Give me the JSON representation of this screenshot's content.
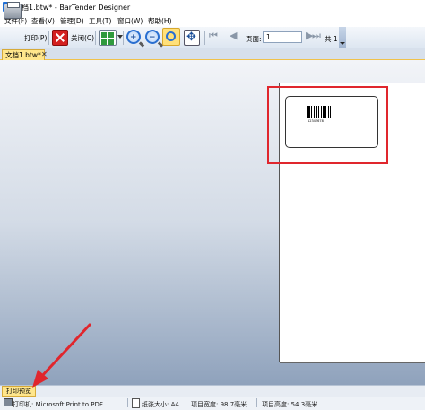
{
  "window": {
    "title": "文档1.btw* - BarTender Designer"
  },
  "menu": {
    "items": [
      "文件(F)",
      "查看(V)",
      "管理(D)",
      "工具(T)",
      "窗口(W)",
      "帮助(H)"
    ]
  },
  "toolbar": {
    "print_label": "打印(P)",
    "close_label": "关闭(C)",
    "page_label": "页面:",
    "page_value": "1",
    "total_label": "共 1"
  },
  "document": {
    "tab_label": "文档1.btw*",
    "tab_close": "✕",
    "barcode_text": "12345678"
  },
  "bottom": {
    "preview_tab": "打印预览"
  },
  "status": {
    "printer": "打印机: Microsoft Print to PDF",
    "paper_size": "纸张大小: A4",
    "item_width": "项目宽度: 98.7毫米",
    "item_height": "项目高度: 54.3毫米"
  },
  "colors": {
    "highlight": "#e0262d",
    "tab_active": "#ffe68c"
  },
  "icons": [
    "app-icon",
    "print-icon",
    "close-icon",
    "grid-icon",
    "zoom-in-icon",
    "zoom-out-icon",
    "zoom-fit-icon",
    "zoom-full-icon",
    "first-page-icon",
    "prev-page-icon",
    "next-page-icon",
    "last-page-icon"
  ]
}
